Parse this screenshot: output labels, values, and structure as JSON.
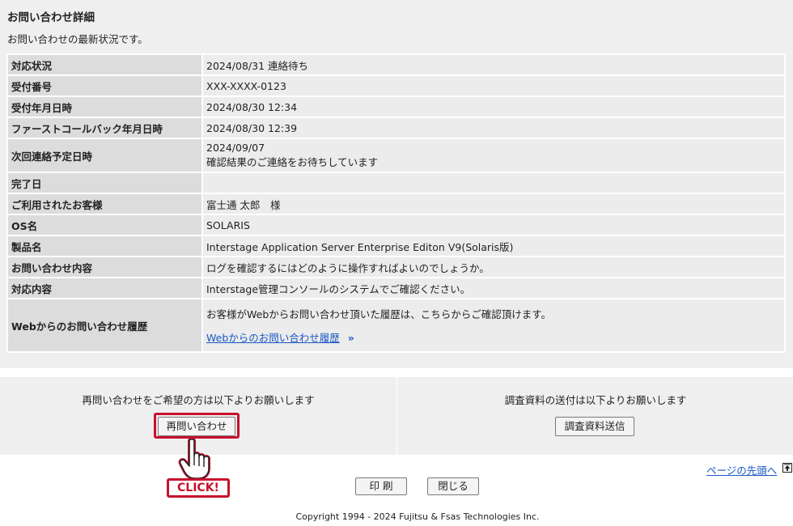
{
  "page": {
    "title": "お問い合わせ詳細",
    "subtitle": "お問い合わせの最新状況です。"
  },
  "details": [
    {
      "label": "対応状況",
      "value": "2024/08/31 連絡待ち"
    },
    {
      "label": "受付番号",
      "value": "XXX-XXXX-0123"
    },
    {
      "label": "受付年月日時",
      "value": "2024/08/30 12:34"
    },
    {
      "label": "ファーストコールバック年月日時",
      "value": "2024/08/30 12:39"
    },
    {
      "label": "次回連絡予定日時",
      "value": "2024/09/07",
      "value2": "確認結果のご連絡をお待ちしています"
    },
    {
      "label": "完了日",
      "value": ""
    },
    {
      "label": "ご利用されたお客様",
      "value": "富士通 太郎　様"
    },
    {
      "label": "OS名",
      "value": "SOLARIS"
    },
    {
      "label": "製品名",
      "value": "Interstage Application Server Enterprise Editon V9(Solaris版)"
    },
    {
      "label": "お問い合わせ内容",
      "value": "ログを確認するにはどのように操作すればよいのでしょうか。"
    },
    {
      "label": "対応内容",
      "value": "Interstage管理コンソールのシステムでご確認ください。"
    },
    {
      "label": "Webからのお問い合わせ履歴",
      "value": "お客様がWebからお問い合わせ頂いた履歴は、こちらからご確認頂けます。",
      "link": "Webからのお問い合わせ履歴",
      "link_icon": "double-chevron-right-icon"
    }
  ],
  "actions": {
    "reinquiry_text": "再問い合わせをご希望の方は以下よりお願いします",
    "reinquiry_button": "再問い合わせ",
    "send_text": "調査資料の送付は以下よりお願いします",
    "send_button": "調査資料送信"
  },
  "annotation": {
    "click_label": "CLICK!",
    "hand_icon": "pointing-hand-icon",
    "color": "#c8102e"
  },
  "footer": {
    "page_top_link": "ページの先頭へ",
    "page_top_icon": "arrow-up-box-icon",
    "print_button": "印 刷",
    "close_button": "閉じる",
    "copyright": "Copyright 1994 - 2024 Fujitsu & Fsas Technologies Inc."
  },
  "colors": {
    "panel_bg": "#efefef",
    "label_bg": "#dcdcdc",
    "value_bg": "#ececec",
    "link": "#1a57c4"
  }
}
